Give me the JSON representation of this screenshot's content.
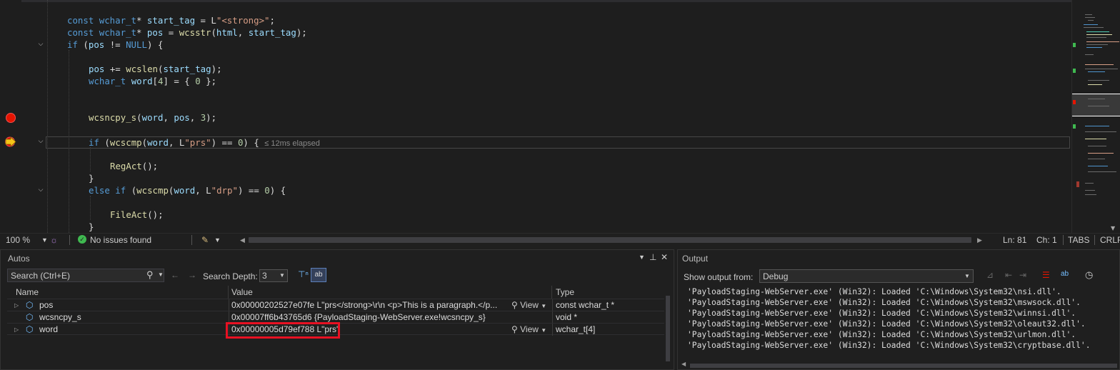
{
  "editor": {
    "code": {
      "l1": {
        "a": "const ",
        "b": "wchar_t",
        "c": "* ",
        "d": "start_tag",
        " e": "",
        "e": " = L",
        "f": "\"<strong>\"",
        "g": ";"
      },
      "l2": {
        "a": "const ",
        "b": "wchar_t",
        "c": "* ",
        "d": "pos",
        "e": " = ",
        "f": "wcsstr",
        "g": "(",
        "h": "html",
        "i": ", ",
        "j": "start_tag",
        "k": ");"
      },
      "l3": {
        "a": "if ",
        "b": "(",
        "c": "pos",
        "d": " != ",
        "e": "NULL",
        "f": ") {"
      },
      "l4": {
        "a": "pos",
        "b": " += ",
        "c": "wcslen",
        "d": "(",
        "e": "start_tag",
        "f": ");"
      },
      "l5": {
        "a": "wchar_t ",
        "b": "word",
        "c": "[",
        "d": "4",
        "e": "] = { ",
        "f": "0",
        "g": " };"
      },
      "l6": {
        "a": "wcsncpy_s",
        "b": "(",
        "c": "word",
        "d": ", ",
        "e": "pos",
        "f": ", ",
        "g": "3",
        "h": ");"
      },
      "l7": {
        "a": "if ",
        "b": "(",
        "c": "wcscmp",
        "d": "(",
        "e": "word",
        "f": ", L",
        "g": "\"prs\"",
        "h": ") == ",
        "i": "0",
        "j": ") {"
      },
      "l8": {
        "a": "RegAct",
        "b": "();"
      },
      "l9": "}",
      "l10": {
        "a": "else if ",
        "b": "(",
        "c": "wcscmp",
        "d": "(",
        "e": "word",
        "f": ", L",
        "g": "\"drp\"",
        "h": ") == ",
        "i": "0",
        "j": ") {"
      },
      "l11": {
        "a": "FileAct",
        "b": "();"
      },
      "l12": "}"
    },
    "elapsed": "≤ 12ms elapsed"
  },
  "statusbar": {
    "zoom": "100 %",
    "issues": "No issues found",
    "line": "Ln: 81",
    "col": "Ch: 1",
    "tabs": "TABS",
    "eol": "CRLF"
  },
  "autos": {
    "title": "Autos",
    "search_placeholder": "Search (Ctrl+E)",
    "depth_label": "Search Depth:",
    "depth_value": "3",
    "columns": {
      "name": "Name",
      "value": "Value",
      "type": "Type"
    },
    "rows": [
      {
        "name": "pos",
        "value": "0x00000202527e07fe L\"prs</strong>\\r\\n        <p>This is a paragraph.</p...",
        "view": "View",
        "type": "const wchar_t *"
      },
      {
        "name": "wcsncpy_s",
        "value": "0x00007ff6b43765d6 {PayloadStaging-WebServer.exe!wcsncpy_s}",
        "view": "",
        "type": "void *"
      },
      {
        "name": "word",
        "value": "0x00000005d79ef788 L\"prs\"",
        "view": "View",
        "type": "wchar_t[4]"
      }
    ]
  },
  "output": {
    "title": "Output",
    "show_from_label": "Show output from:",
    "source": "Debug",
    "lines": [
      "'PayloadStaging-WebServer.exe' (Win32): Loaded 'C:\\Windows\\System32\\nsi.dll'.",
      "'PayloadStaging-WebServer.exe' (Win32): Loaded 'C:\\Windows\\System32\\mswsock.dll'.",
      "'PayloadStaging-WebServer.exe' (Win32): Loaded 'C:\\Windows\\System32\\winnsi.dll'.",
      "'PayloadStaging-WebServer.exe' (Win32): Loaded 'C:\\Windows\\System32\\oleaut32.dll'.",
      "'PayloadStaging-WebServer.exe' (Win32): Loaded 'C:\\Windows\\System32\\urlmon.dll'.",
      "'PayloadStaging-WebServer.exe' (Win32): Loaded 'C:\\Windows\\System32\\cryptbase.dll'."
    ]
  },
  "colors": {
    "breakpoint": "#e51400",
    "highlight": "#e81123",
    "ok": "#3fb950"
  }
}
